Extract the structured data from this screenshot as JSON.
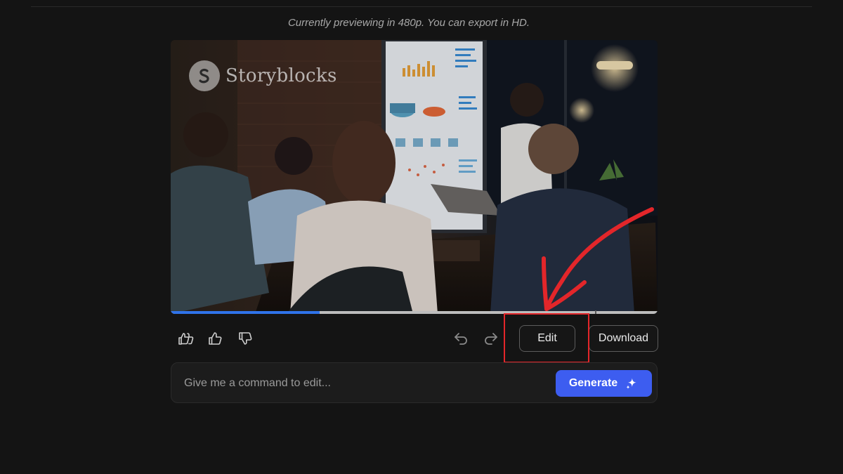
{
  "preview": {
    "note": "Currently previewing in 480p. You can export in HD."
  },
  "video": {
    "watermark_text": "Storyblocks",
    "progress_fraction": 0.306
  },
  "toolbar": {
    "icons": {
      "double_like": "double-thumbs-up-icon",
      "like": "thumbs-up-icon",
      "dislike": "thumbs-down-icon",
      "undo": "undo-icon",
      "redo": "redo-icon"
    },
    "edit_label": "Edit",
    "download_label": "Download"
  },
  "command": {
    "placeholder": "Give me a command to edit...",
    "value": "",
    "generate_label": "Generate",
    "generate_icon": "sparkle-icon"
  },
  "colors": {
    "background": "#141414",
    "accent": "#3d5df0",
    "progress": "#2f73ea",
    "annotation": "#e3262a"
  }
}
